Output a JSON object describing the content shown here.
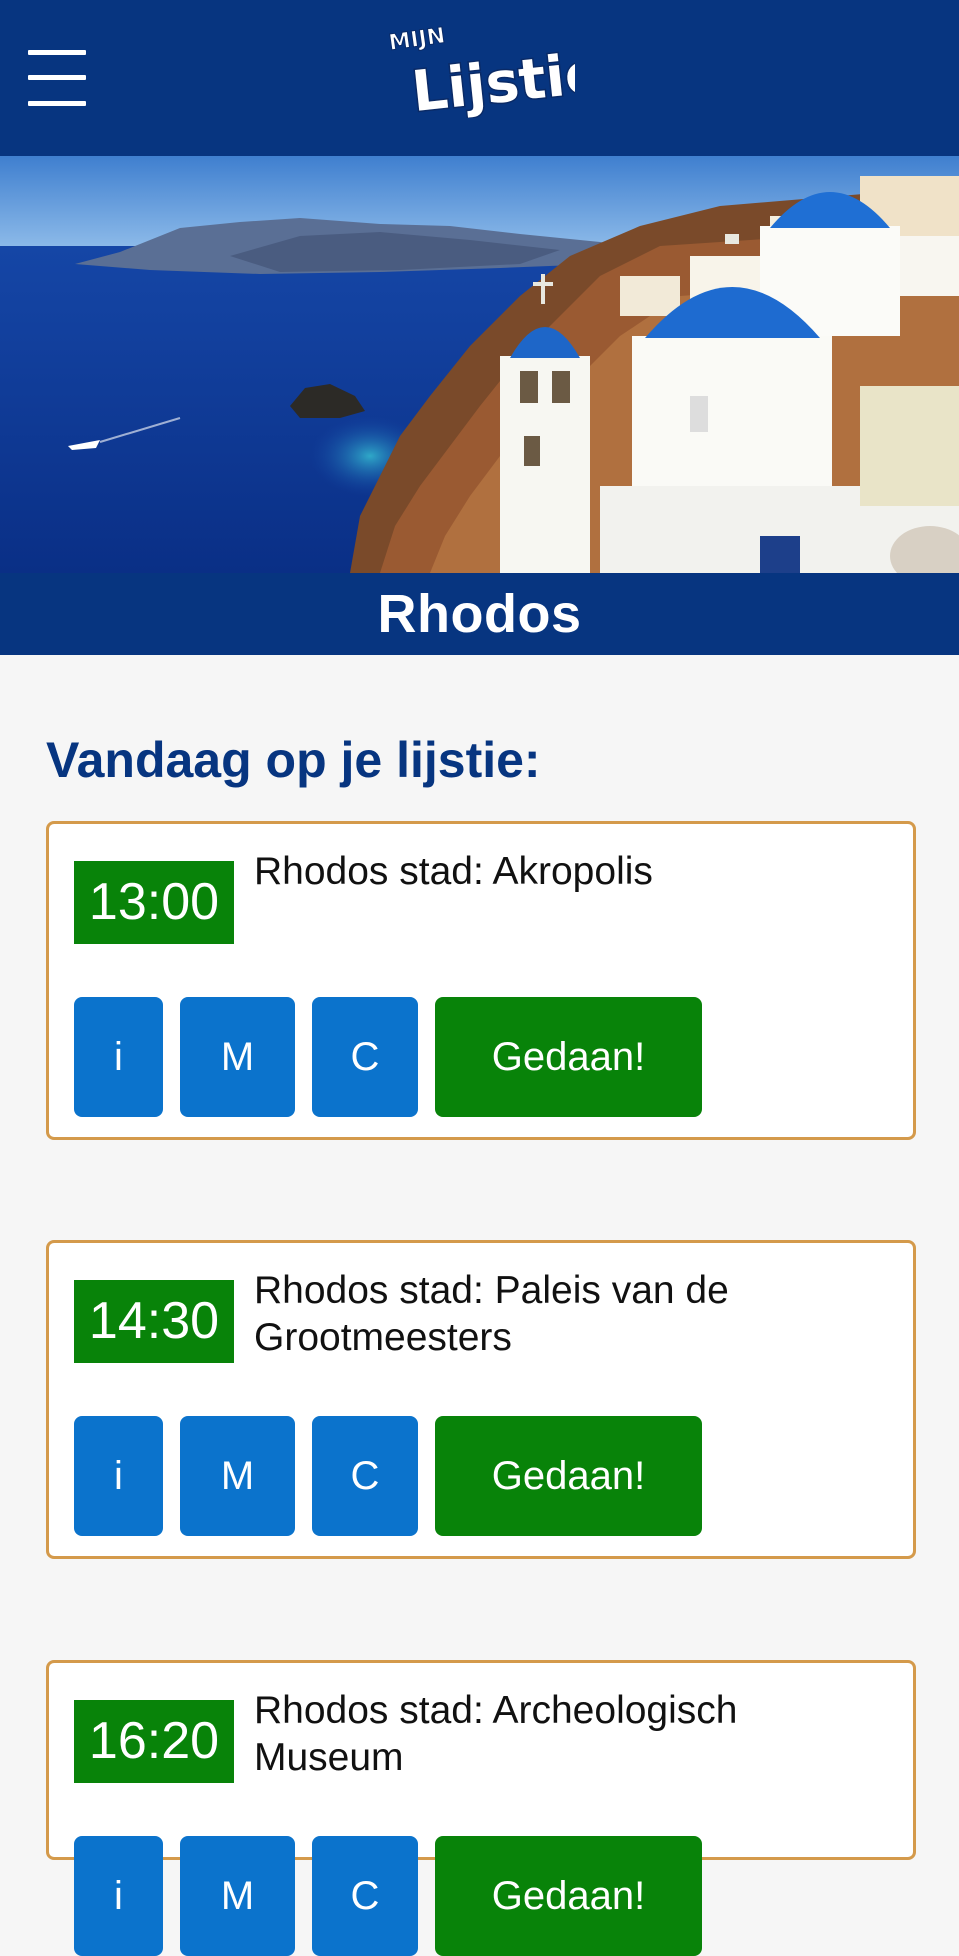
{
  "header": {
    "menu_icon": "hamburger-menu-icon",
    "logo_alt": "Mijn Lijstie",
    "logo_small": "MIJN",
    "logo_big": "Lijstie",
    "background_color": "#073580"
  },
  "destination": {
    "title": "Rhodos"
  },
  "today": {
    "heading": "Vandaag op je lijstie:",
    "items": [
      {
        "time": "13:00",
        "activity": "Rhodos stad: Akropolis",
        "buttons": {
          "info": "i",
          "map": "M",
          "c": "C",
          "done": "Gedaan!"
        }
      },
      {
        "time": "14:30",
        "activity": "Rhodos stad: Paleis van de Grootmeesters",
        "buttons": {
          "info": "i",
          "map": "M",
          "c": "C",
          "done": "Gedaan!"
        }
      },
      {
        "time": "16:20",
        "activity": "Rhodos stad: Archeologisch Museum",
        "buttons": {
          "info": "i",
          "map": "M",
          "c": "C",
          "done": "Gedaan!"
        }
      }
    ]
  },
  "colors": {
    "brand_blue": "#073580",
    "button_blue": "#0b73cc",
    "done_green": "#088309",
    "card_border": "#d49a4b",
    "page_bg": "#f6f6f6"
  }
}
